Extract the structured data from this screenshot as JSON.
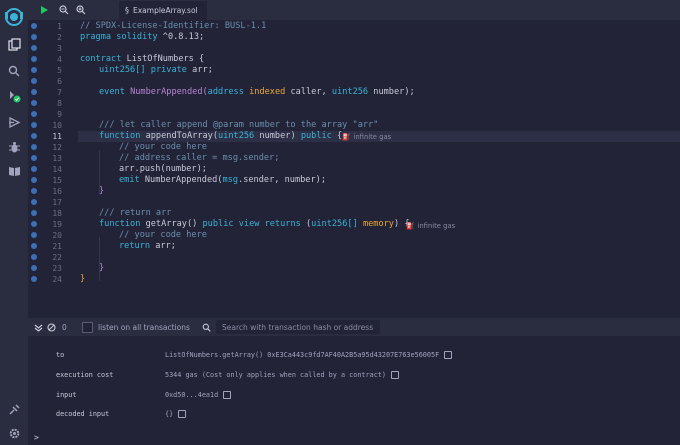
{
  "tab": {
    "file_name": "ExampleArray.sol"
  },
  "gutter": {
    "line_numbers": [
      "1",
      "2",
      "3",
      "4",
      "5",
      "6",
      "7",
      "8",
      "9",
      "10",
      "11",
      "12",
      "13",
      "14",
      "15",
      "16",
      "17",
      "18",
      "19",
      "20",
      "21",
      "22",
      "23",
      "24"
    ],
    "active_line": "11"
  },
  "code": {
    "l1": "// SPDX-License-Identifier: BUSL-1.1",
    "l2_kw": "pragma solidity",
    "l2_rest": " ^0.8.13;",
    "l4_kw": "contract",
    "l4_rest": " ListOfNumbers {",
    "l5_type": "uint256[]",
    "l5_kw": "private",
    "l5_rest": "arr;",
    "l7_kw": "event",
    "l7_name": "NumberAppended(",
    "l7_type1": "address",
    "l7_indexed": "indexed",
    "l7_mid": "caller, ",
    "l7_type2": "uint256",
    "l7_end": " number);",
    "l10": "/// let caller append @param number to the array \"arr\"",
    "l11_kw": "function",
    "l11_name": " appendToArray(",
    "l11_type": "uint256",
    "l11_mid": " number) ",
    "l11_kw2": "public",
    "l11_end": " {",
    "l12": "// your code here",
    "l13": "// address caller = msg.sender;",
    "l14": "arr.push(number);",
    "l15_kw": "emit",
    "l15_name": " NumberAppended(",
    "l15_msg": "msg",
    "l15_rest": ".sender, number);",
    "l16": "}",
    "l18": "/// return arr",
    "l19_kw": "function",
    "l19_name": " getArray() ",
    "l19_kw2": "public view returns",
    "l19_open": " (",
    "l19_type": "uint256[]",
    "l19_mem": "memory",
    "l19_end": ") {",
    "l20": "// your code here",
    "l21_kw": "return",
    "l21_rest": " arr;",
    "l23": "}",
    "l24": "}"
  },
  "gas_hints": {
    "append": "infinite gas",
    "get": "infinite gas"
  },
  "terminal_bar": {
    "count": "0",
    "listen_label": "listen on all transactions",
    "search_placeholder": "Search with transaction hash or address"
  },
  "terminal": {
    "rows": [
      {
        "key": "to",
        "value": "ListOfNumbers.getArray() 0xE3Ca443c9fd7AF40A2B5a95d43207E763e56005F"
      },
      {
        "key": "execution cost",
        "value": "5344 gas (Cost only applies when called by a contract)"
      },
      {
        "key": "input",
        "value": "0xd50...4ea1d"
      },
      {
        "key": "decoded input",
        "value": "{}"
      }
    ],
    "prompt": ">"
  },
  "colors": {
    "background": "#222336",
    "panel": "#2a2c3f",
    "accent_blue": "#3bb3d8",
    "accent_green": "#1fc765",
    "highlight_orange": "#e8a93b"
  }
}
